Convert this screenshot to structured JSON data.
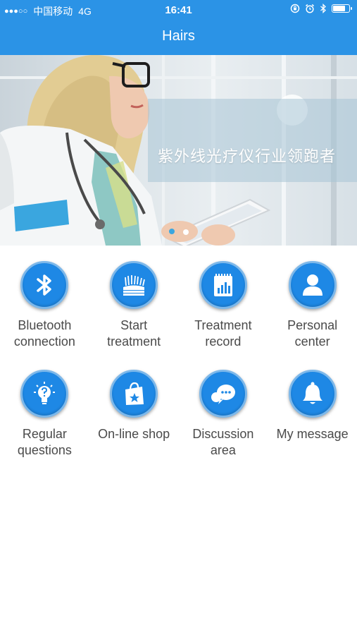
{
  "status_bar": {
    "carrier": "中国移动",
    "network": "4G",
    "time": "16:41",
    "signal_bars": "●●●○○",
    "battery_level": 0.75
  },
  "nav": {
    "title": "Hairs"
  },
  "banner": {
    "slogan": "紫外线光疗仪行业领跑者"
  },
  "menu": [
    {
      "label": "Bluetooth\nconnection",
      "icon": "bluetooth-icon"
    },
    {
      "label": "Start\ntreatment",
      "icon": "hair-follicle-icon"
    },
    {
      "label": "Treatment\nrecord",
      "icon": "calendar-chart-icon"
    },
    {
      "label": "Personal\ncenter",
      "icon": "user-icon"
    },
    {
      "label": "Regular\nquestions",
      "icon": "lightbulb-question-icon"
    },
    {
      "label": "On-line shop",
      "icon": "shopping-bag-icon"
    },
    {
      "label": "Discussion\narea",
      "icon": "chat-bubble-icon"
    },
    {
      "label": "My message",
      "icon": "bell-icon"
    }
  ],
  "colors": {
    "primary": "#2b93e6",
    "icon_bg": "#1e88e5",
    "label_text": "#4a4a4a"
  }
}
